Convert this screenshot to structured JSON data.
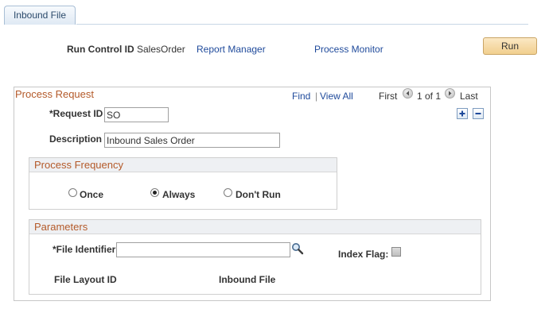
{
  "tab": {
    "label": "Inbound File"
  },
  "header": {
    "run_control_label": "Run Control ID",
    "run_control_value": "SalesOrder",
    "report_manager": "Report Manager",
    "process_monitor": "Process Monitor",
    "run_label": "Run"
  },
  "process_request": {
    "title": "Process Request",
    "find": "Find",
    "separator": "|",
    "view_all": "View All",
    "first": "First",
    "count": "1 of 1",
    "last": "Last",
    "request_id_label": "*Request ID",
    "request_id_value": "SO",
    "description_label": "Description",
    "description_value": "Inbound Sales Order"
  },
  "frequency": {
    "title": "Process Frequency",
    "options": [
      {
        "label": "Once",
        "selected": false
      },
      {
        "label": "Always",
        "selected": true
      },
      {
        "label": "Don't Run",
        "selected": false
      }
    ]
  },
  "parameters": {
    "title": "Parameters",
    "file_identifier_label": "*File Identifier",
    "file_identifier_value": "",
    "index_flag_label": "Index Flag:",
    "index_flag_checked": false,
    "file_layout_label": "File Layout ID",
    "inbound_file_label": "Inbound File"
  }
}
